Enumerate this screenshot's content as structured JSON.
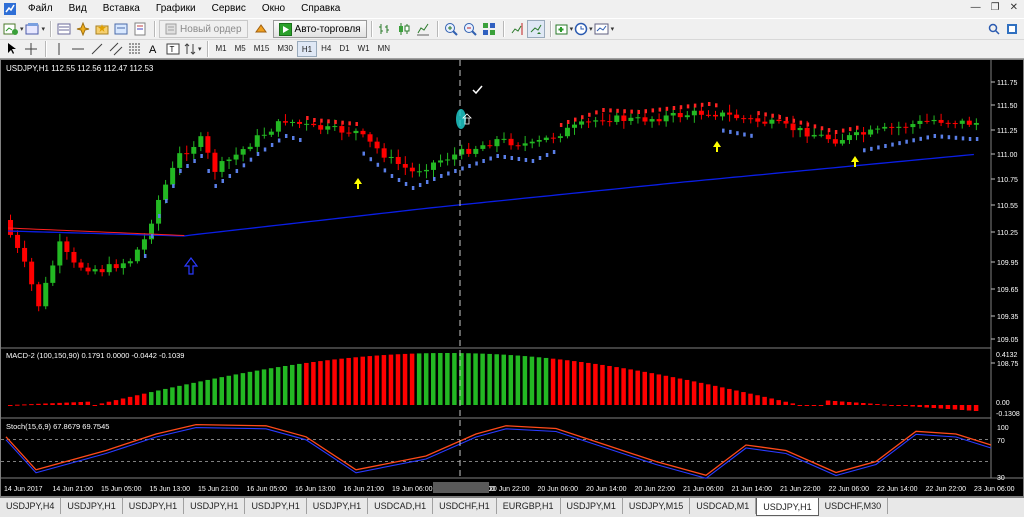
{
  "menu": [
    "Файл",
    "Вид",
    "Вставка",
    "Графики",
    "Сервис",
    "Окно",
    "Справка"
  ],
  "toolbar": {
    "new_order": "Новый ордер",
    "auto_trading": "Авто-торговля"
  },
  "timeframes": [
    "M1",
    "M5",
    "M15",
    "M30",
    "H1",
    "H4",
    "D1",
    "W1",
    "MN"
  ],
  "chart": {
    "header": "USDJPY,H1  112.55 112.56 112.47 112.53",
    "price_labels": [
      "111.75",
      "111.50",
      "111.25",
      "111.00",
      "110.75",
      "110.55",
      "110.25",
      "109.95",
      "109.65",
      "109.35",
      "109.05",
      "108.75"
    ],
    "macd_header": "MACD-2 (100,150,90) 0.1791 0.0000 -0.0442 -0.1039",
    "macd_labels": [
      "0.4132",
      "0.00",
      "-0.1308"
    ],
    "stoch_header": "Stoch(15,6,9) 67.8679 69.7545",
    "stoch_labels": [
      "100",
      "70",
      "30",
      "0"
    ],
    "time_labels": [
      "14 Jun 2017",
      "14 Jun 21:00",
      "15 Jun 05:00",
      "15 Jun 13:00",
      "15 Jun 21:00",
      "16 Jun 05:00",
      "16 Jun 13:00",
      "16 Jun 21:00",
      "19 Jun 06:00",
      "2017.06.19 18:00",
      "20 Jun 22:00",
      "20 Jun 06:00",
      "20 Jun 14:00",
      "20 Jun 22:00",
      "21 Jun 06:00",
      "21 Jun 14:00",
      "21 Jun 22:00",
      "22 Jun 06:00",
      "22 Jun 14:00",
      "22 Jun 22:00",
      "23 Jun 06:00"
    ],
    "colors": {
      "bull": "#23b823",
      "bear": "#ff0000",
      "ma": "#0a1ee6",
      "dots_up": "#5a7fe8",
      "dots_down": "#ff2222",
      "stoch_main": "#ff4a1a",
      "stoch_signal": "#2a3aff",
      "arrow": "#ffff00"
    }
  },
  "tabs": [
    "USDJPY,H4",
    "USDJPY,H1",
    "USDJPY,H1",
    "USDJPY,H1",
    "USDJPY,H1",
    "USDJPY,H1",
    "USDCAD,H1",
    "USDCHF,H1",
    "EURGBP,H1",
    "USDJPY,M1",
    "USDJPY,M15",
    "USDCAD,M1",
    "USDJPY,H1",
    "USDCHF,M30"
  ],
  "active_tab": 12
}
